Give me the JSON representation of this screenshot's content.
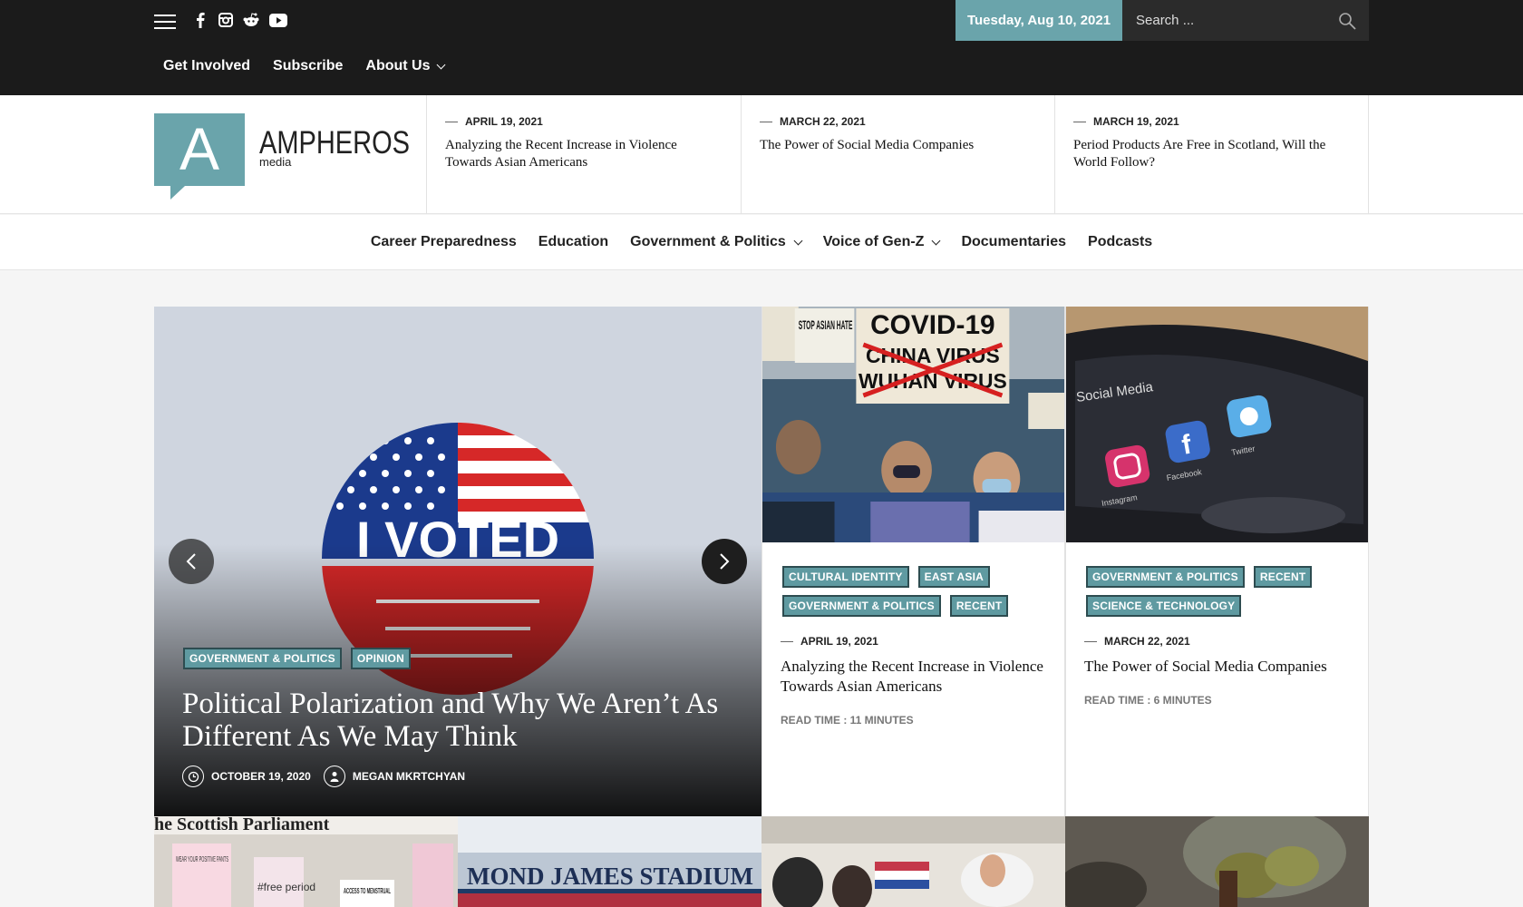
{
  "topbar": {
    "date": "Tuesday, Aug 10, 2021",
    "search_placeholder": "Search ...",
    "social_icons": [
      "facebook-icon",
      "instagram-icon",
      "reddit-icon",
      "youtube-icon"
    ],
    "nav": [
      {
        "label": "Get Involved"
      },
      {
        "label": "Subscribe"
      },
      {
        "label": "About Us"
      }
    ]
  },
  "brand": {
    "letter": "A",
    "name": "AMPHEROS",
    "sub": "media",
    "accent": "#6aa4ab"
  },
  "latest": [
    {
      "date": "April 19, 2021",
      "title": "Analyzing the Recent Increase in Violence Towards Asian Americans"
    },
    {
      "date": "March 22, 2021",
      "title": "The Power of Social Media Companies"
    },
    {
      "date": "March 19, 2021",
      "title": "Period Products Are Free in Scotland, Will the World Follow?"
    }
  ],
  "main_nav": [
    {
      "label": "Career Preparedness"
    },
    {
      "label": "Education"
    },
    {
      "label": "Government & Politics"
    },
    {
      "label": "Voice of Gen-Z"
    },
    {
      "label": "Documentaries"
    },
    {
      "label": "Podcasts"
    }
  ],
  "hero": {
    "badge_text": "I VOTED",
    "tags": [
      "Government & Politics",
      "Opinion"
    ],
    "title": "Political Polarization and Why We Aren’t As Different As We May Think",
    "date": "October 19, 2020",
    "author": "Megan Mkrtchyan"
  },
  "cards": [
    {
      "tags": [
        "Cultural Identity",
        "East Asia",
        "Government & Politics",
        "Recent"
      ],
      "date": "April 19, 2021",
      "title": "Analyzing the Recent Increase in Violence Towards Asian Americans",
      "read_time": "Read Time : 11 Minutes",
      "sign_main": "COVID-19",
      "sign_lines": [
        "CHINA VIRUS",
        "WUHAN VIRUS"
      ],
      "sign_stop": "STOP ASIAN HATE"
    },
    {
      "tags": [
        "Government & Politics",
        "Recent",
        "Science & Technology"
      ],
      "date": "March 22, 2021",
      "title": "The Power of Social Media Companies",
      "read_time": "Read Time : 6 Minutes",
      "screen_labels": [
        "Social Media",
        "Instagram",
        "Facebook",
        "Twitter"
      ]
    }
  ],
  "bottom": {
    "scottish": "he Scottish Parliament",
    "sign_a": "WEAR YOUR POSITIVE PANTS",
    "sign_b": "#free period",
    "sign_c": "ACCESS TO MENSTRUAL",
    "stadium": "MOND JAMES STADIUM"
  }
}
